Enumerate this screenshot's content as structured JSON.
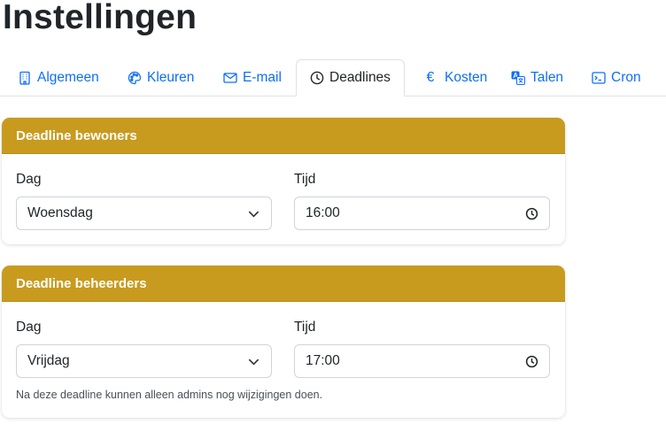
{
  "page": {
    "title": "Instellingen"
  },
  "tabs": [
    {
      "label": "Algemeen",
      "icon": "building-icon"
    },
    {
      "label": "Kleuren",
      "icon": "palette-icon"
    },
    {
      "label": "E-mail",
      "icon": "envelope-icon"
    },
    {
      "label": "Deadlines",
      "icon": "clock-icon",
      "active": true
    },
    {
      "label": "Kosten",
      "icon": "euro-icon"
    },
    {
      "label": "Talen",
      "icon": "translate-icon"
    },
    {
      "label": "Cron",
      "icon": "terminal-icon"
    }
  ],
  "cards": {
    "bewoners": {
      "header": "Deadline bewoners",
      "day_label": "Dag",
      "day_value": "Woensdag",
      "time_label": "Tijd",
      "time_value": "16:00"
    },
    "beheerders": {
      "header": "Deadline beheerders",
      "day_label": "Dag",
      "day_value": "Vrijdag",
      "time_label": "Tijd",
      "time_value": "17:00",
      "help": "Na deze deadline kunnen alleen admins nog wijzigingen doen."
    }
  },
  "colors": {
    "accent": "#c89b1f",
    "link": "#0d6efd"
  }
}
